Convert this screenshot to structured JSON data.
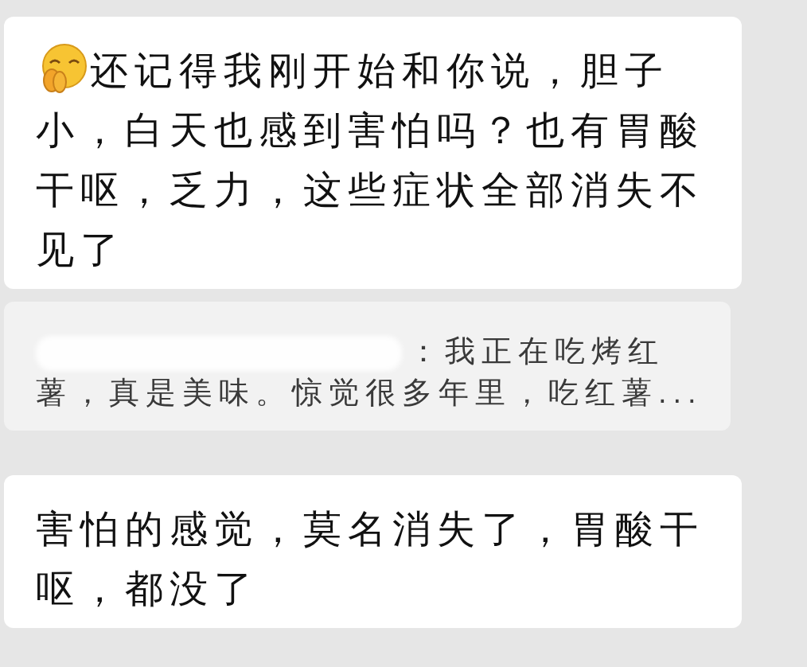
{
  "messages": [
    {
      "kind": "text",
      "emoji": true,
      "first_line": "还记得我刚开始和你说，胆子",
      "text": "小，白天也感到害怕吗？也有胃酸干呕，乏力，这些症状全部消失不见了"
    },
    {
      "kind": "quote",
      "redacted": true,
      "text": "：我正在吃烤红薯，真是美味。惊觉很多年里，吃红薯..."
    },
    {
      "kind": "text",
      "emoji": false,
      "text": "害怕的感觉，莫名消失了，胃酸干呕，都没了"
    }
  ]
}
